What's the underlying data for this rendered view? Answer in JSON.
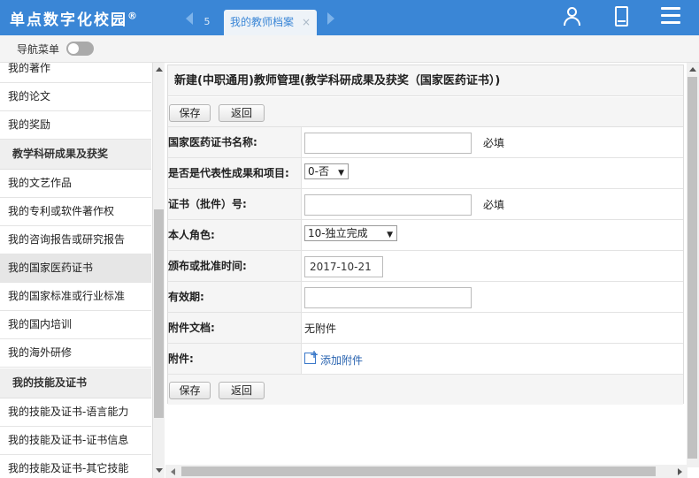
{
  "header": {
    "brand": "单点数字化校园",
    "brand_mark": "®",
    "tab_small": "5",
    "active_tab": "我的教师档案",
    "tab_close": "×"
  },
  "nav": {
    "label": "导航菜单"
  },
  "sidebar": {
    "items": [
      "我的著作",
      "我的论文",
      "我的奖励",
      "教学科研成果及获奖",
      "我的文艺作品",
      "我的专利或软件著作权",
      "我的咨询报告或研究报告",
      "我的国家医药证书",
      "我的国家标准或行业标准",
      "我的国内培训",
      "我的海外研修",
      "我的技能及证书",
      "我的技能及证书-语言能力",
      "我的技能及证书-证书信息",
      "我的技能及证书-其它技能"
    ]
  },
  "form": {
    "title": "新建(中职通用)教师管理(教学科研成果及获奖（国家医药证书）)",
    "save": "保存",
    "back": "返回",
    "fields": {
      "cert_name": {
        "label": "国家医药证书名称:",
        "value": "",
        "required": "必填"
      },
      "representative": {
        "label": "是否是代表性成果和项目:",
        "value": "0-否"
      },
      "cert_no": {
        "label": "证书（批件）号:",
        "value": "",
        "required": "必填"
      },
      "role": {
        "label": "本人角色:",
        "value": "10-独立完成"
      },
      "issue_date": {
        "label": "颁布或批准时间:",
        "value": "2017-10-21"
      },
      "valid_period": {
        "label": "有效期:",
        "value": ""
      },
      "attachment_doc": {
        "label": "附件文档:",
        "value": "无附件"
      },
      "attachment": {
        "label": "附件:",
        "action": "添加附件"
      }
    }
  },
  "icons": {
    "user": "user-icon",
    "phone": "phone-icon",
    "menu": "menu-icon",
    "attach": "add-attachment-icon"
  },
  "colors": {
    "header": "#3a86d6",
    "link": "#2a64b0"
  }
}
